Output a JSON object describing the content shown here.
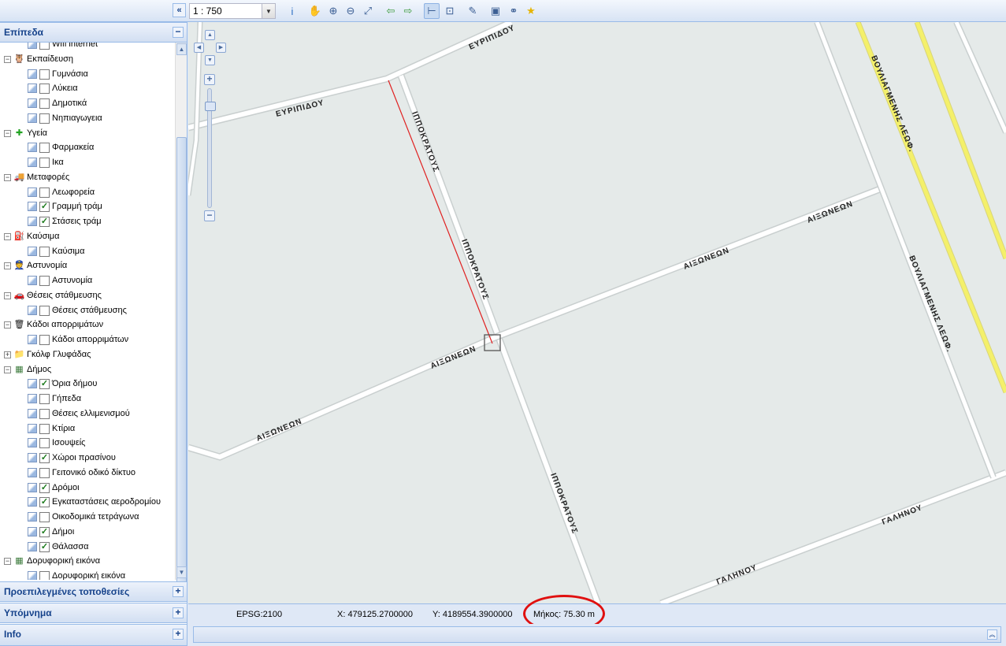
{
  "toolbar": {
    "collapse_label": "«",
    "scale_value": "1 : 750",
    "tools": [
      {
        "name": "info-icon",
        "glyph": "i",
        "active": false
      },
      {
        "name": "pan-hand-icon",
        "glyph": "✋",
        "active": false
      },
      {
        "name": "zoom-in-icon",
        "glyph": "⊕",
        "active": false
      },
      {
        "name": "zoom-out-icon",
        "glyph": "⊖",
        "active": false
      },
      {
        "name": "full-extent-icon",
        "glyph": "⤢",
        "active": false
      },
      {
        "name": "history-back-icon",
        "glyph": "⇦",
        "active": false
      },
      {
        "name": "history-forward-icon",
        "glyph": "⇨",
        "active": false
      },
      {
        "name": "measure-length-icon",
        "glyph": "⊢",
        "active": true
      },
      {
        "name": "measure-area-icon",
        "glyph": "⊡",
        "active": false
      },
      {
        "name": "print-map-icon",
        "glyph": "✎",
        "active": false
      },
      {
        "name": "export-image-icon",
        "glyph": "▣",
        "active": false
      },
      {
        "name": "binoculars-icon",
        "glyph": "⚭",
        "active": false
      },
      {
        "name": "favorites-star-icon",
        "glyph": "★",
        "active": false
      }
    ]
  },
  "panels": {
    "layers_title": "Επίπεδα",
    "locations_title": "Προεπιλεγμένες τοποθεσίες",
    "legend_title": "Υπόμνημα",
    "info_title": "Info",
    "collapse_tool": "−",
    "expand_tool": "+"
  },
  "tree": [
    {
      "type": "leaf",
      "label": "Wifi internet",
      "checked": false
    },
    {
      "type": "group",
      "label": "Εκπαίδευση",
      "expanded": true,
      "icon": "owl-icon",
      "glyph": "🦉",
      "color": "#333"
    },
    {
      "type": "leaf",
      "label": "Γυμνάσια",
      "checked": false
    },
    {
      "type": "leaf",
      "label": "Λύκεια",
      "checked": false
    },
    {
      "type": "leaf",
      "label": "Δημοτικά",
      "checked": false
    },
    {
      "type": "leaf",
      "label": "Νηπιαγωγεια",
      "checked": false
    },
    {
      "type": "group",
      "label": "Υγεία",
      "expanded": true,
      "icon": "health-cross-icon",
      "glyph": "✚",
      "color": "#22a322"
    },
    {
      "type": "leaf",
      "label": "Φαρμακεία",
      "checked": false
    },
    {
      "type": "leaf",
      "label": "Ικα",
      "checked": false
    },
    {
      "type": "group",
      "label": "Μεταφορές",
      "expanded": true,
      "icon": "truck-icon",
      "glyph": "🚚",
      "color": "#1f6b1f"
    },
    {
      "type": "leaf",
      "label": "Λεωφορεία",
      "checked": false
    },
    {
      "type": "leaf",
      "label": "Γραμμή τράμ",
      "checked": true
    },
    {
      "type": "leaf",
      "label": "Στάσεις τράμ",
      "checked": true
    },
    {
      "type": "group",
      "label": "Καύσιμα",
      "expanded": true,
      "icon": "fuel-pump-icon",
      "glyph": "⛽",
      "color": "#222"
    },
    {
      "type": "leaf",
      "label": "Καύσιμα",
      "checked": false
    },
    {
      "type": "group",
      "label": "Αστυνομία",
      "expanded": true,
      "icon": "police-officer-icon",
      "glyph": "👮",
      "color": "#2b4a7a"
    },
    {
      "type": "leaf",
      "label": "Αστυνομία",
      "checked": false
    },
    {
      "type": "group",
      "label": "Θέσεις στάθμευσης",
      "expanded": true,
      "icon": "parking-car-icon",
      "glyph": "🚗",
      "color": "#6b6b2a"
    },
    {
      "type": "leaf",
      "label": "Θέσεις στάθμευσης",
      "checked": false
    },
    {
      "type": "group",
      "label": "Κάδοι απορριμάτων",
      "expanded": true,
      "icon": "trash-bin-icon",
      "glyph": "🗑",
      "color": "#111"
    },
    {
      "type": "leaf",
      "label": "Κάδοι απορριμάτων",
      "checked": false
    },
    {
      "type": "group",
      "label": "Γκόλφ Γλυφάδας",
      "expanded": false,
      "icon": "folder-icon",
      "glyph": "📁",
      "color": "#d9a520"
    },
    {
      "type": "group",
      "label": "Δήμος",
      "expanded": true,
      "icon": "municipality-map-icon",
      "glyph": "▦",
      "color": "#3b7a3b"
    },
    {
      "type": "leaf",
      "label": "Όρια δήμου",
      "checked": true
    },
    {
      "type": "leaf",
      "label": "Γήπεδα",
      "checked": false
    },
    {
      "type": "leaf",
      "label": "Θέσεις ελλιμενισμού",
      "checked": false
    },
    {
      "type": "leaf",
      "label": "Κτίρια",
      "checked": false
    },
    {
      "type": "leaf",
      "label": "Ισουψείς",
      "checked": false
    },
    {
      "type": "leaf",
      "label": "Χώροι πρασίνου",
      "checked": true
    },
    {
      "type": "leaf",
      "label": "Γειτονικό οδικό δίκτυο",
      "checked": false
    },
    {
      "type": "leaf",
      "label": "Δρόμοι",
      "checked": true
    },
    {
      "type": "leaf",
      "label": "Εγκαταστάσεις αεροδρομίου",
      "checked": true
    },
    {
      "type": "leaf",
      "label": "Οικοδομικά τετράγωνα",
      "checked": false
    },
    {
      "type": "leaf",
      "label": "Δήμοι",
      "checked": true
    },
    {
      "type": "leaf",
      "label": "Θάλασσα",
      "checked": true
    },
    {
      "type": "group",
      "label": "Δορυφορική εικόνα",
      "expanded": true,
      "icon": "satellite-image-icon",
      "glyph": "▦",
      "color": "#3b7a3b"
    },
    {
      "type": "leaf",
      "label": "Δορυφορική εικόνα",
      "checked": false
    }
  ],
  "map": {
    "streets": {
      "evripidou": "ΕΥΡΙΠΙΔΟΥ",
      "ippokratous": "ΙΠΠΟΚΡΑΤΟΥΣ",
      "aixoneon": "ΑΙΞΩΝΕΩΝ",
      "vouliagmenis": "ΒΟΥΛΙΑΓΜΕΝΗΣ ΛΕΩΦ.",
      "galinou": "ΓΑΛΗΝΟΥ"
    },
    "colors": {
      "background": "#e5eae9",
      "road_fill": "#ffffff",
      "road_edge": "#c9cfcf",
      "avenue_fill": "#f4f06a",
      "measure_line": "#e02020"
    }
  },
  "status": {
    "epsg": "EPSG:2100",
    "x": "X: 479125.2700000",
    "y": "Y: 4189554.3900000",
    "length": "Μήκος: 75.30 m"
  }
}
